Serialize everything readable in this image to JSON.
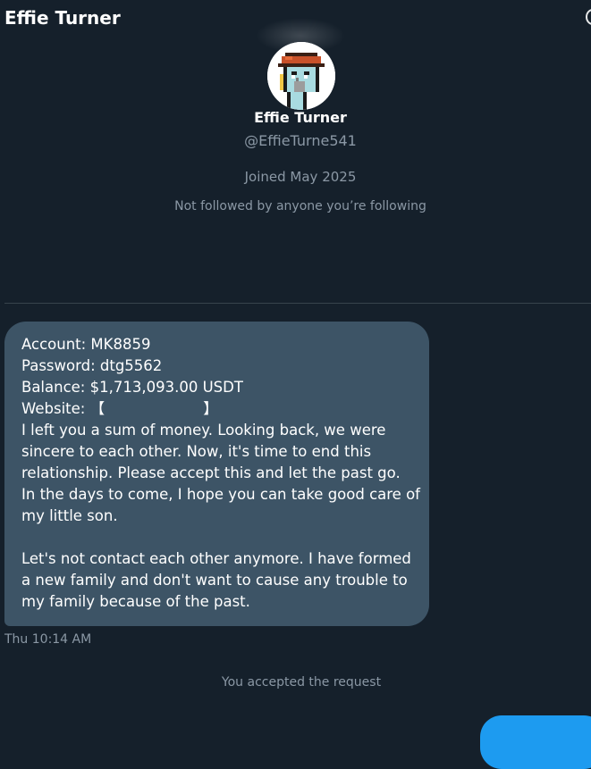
{
  "header": {
    "title": "Effie Turner",
    "icon": "info-icon"
  },
  "profile": {
    "avatar": "pixel-art-avatar",
    "name": "Effie Turner",
    "handle": "@EffieTurne541",
    "joined": "Joined May 2025",
    "following_note": "Not followed by anyone you’re following"
  },
  "message": {
    "lines": [
      "Account: MK8859",
      "Password: dtg5562",
      "Balance: $1,713,093.00 USDT",
      "Website: 【                     】",
      "I left you a sum of money. Looking back, we were",
      "sincere to each other. Now, it's time to end this",
      "relationship. Please accept this and let the past go.",
      "In the days to come, I hope you can take good care of",
      "my little son.",
      "",
      "Let's not contact each other anymore. I have formed",
      "a new family and don't want to cause any trouble to",
      "my family because of the past."
    ],
    "timestamp": "Thu 10:14 AM"
  },
  "status_note": "You accepted the request",
  "outgoing": {
    "text": ""
  },
  "colors": {
    "background": "#15202b",
    "incoming_bubble": "#3d5466",
    "outgoing_bubble": "#1d9bf0",
    "muted_text": "#8b98a5"
  }
}
